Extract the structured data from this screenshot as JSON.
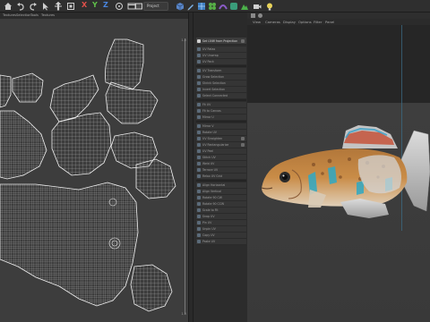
{
  "toolbar": {
    "axis_x": "X",
    "axis_y": "Y",
    "axis_z": "Z",
    "project_select": "Project",
    "colors": {
      "x": "#e0504a",
      "y": "#5fbf4a",
      "z": "#4a86e0"
    }
  },
  "uv_menu": {
    "items": [
      "Textures",
      "Selection",
      "Tools",
      "Textures"
    ]
  },
  "uv_editor": {
    "tick_label_top": "1.0",
    "tick_label_bottom": "1.0"
  },
  "command_panel": {
    "header_label": "Set UVW from Projection",
    "items": [
      "Set UVW from Projection",
      "UV Relax",
      "UV Unwrap",
      "UV Pack",
      "UV Transform",
      "Grow Selection",
      "Shrink Selection",
      "Invert Selection",
      "Select Connected",
      "Fit UV",
      "Fit to Canvas",
      "Mirror U",
      "Mirror V",
      "Rotate UV",
      "UV Straighten",
      "UV Rectangularize",
      "UV Peel",
      "Stitch UV",
      "Weld UV",
      "Terrace UV",
      "Relax UV Grid",
      "Align Horizontal",
      "Align Vertical",
      "Rotate 90 CW",
      "Rotate 90 CCW",
      "Scale to Fit",
      "Snap UV",
      "Pin UV",
      "Unpin UV",
      "Copy UV",
      "Paste UV"
    ]
  },
  "viewport": {
    "menu": [
      "View",
      "Cameras",
      "Display",
      "Options",
      "Filter",
      "Panel"
    ]
  }
}
